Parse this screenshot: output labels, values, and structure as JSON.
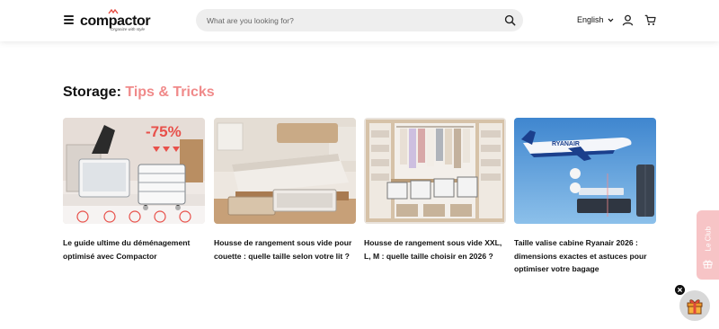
{
  "header": {
    "menu_icon": "hamburger-menu-icon",
    "logo": {
      "name": "compactor",
      "tagline": "Organize with style"
    },
    "search": {
      "placeholder": "What are you looking for?",
      "value": "",
      "icon": "search-icon"
    },
    "language": "English",
    "user_icon": "user-icon",
    "cart_icon": "cart-icon"
  },
  "section": {
    "title_prefix": "Storage: ",
    "title_accent": "Tips & Tricks",
    "cards": [
      {
        "title": "Le guide ultime du déménagement optimisé avec Compactor",
        "image": "vacuum-bags-moving",
        "badge": "-75%"
      },
      {
        "title": "Housse de rangement sous vide pour couette : quelle taille selon votre lit ?",
        "image": "under-bed-storage"
      },
      {
        "title": "Housse de rangement sous vide XXL, L, M : quelle taille choisir en 2026 ?",
        "image": "wardrobe-storage"
      },
      {
        "title": "Taille valise cabine Ryanair 2026 : dimensions exactes et astuces pour optimiser votre bagage",
        "image": "ryanair-plane-luggage",
        "airline": "RYANAIR"
      }
    ]
  },
  "floating": {
    "club_label": "Le Club",
    "gift_icon": "gift-icon",
    "close_icon": "close-icon"
  },
  "colors": {
    "accent": "#f08a8a",
    "search_bg": "#eeeeee",
    "club_bg": "#f7c4c6"
  }
}
